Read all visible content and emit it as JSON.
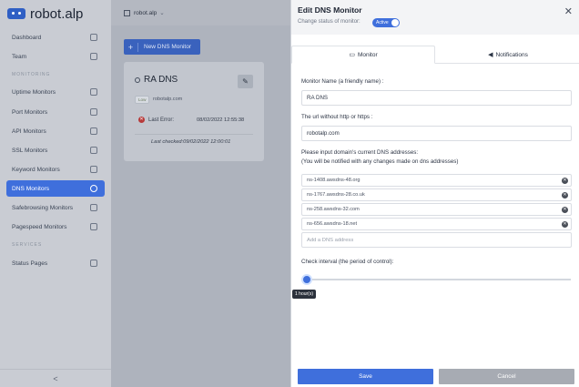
{
  "app": {
    "brand": "robot.alp"
  },
  "sidebar": {
    "items": [
      {
        "label": "Dashboard",
        "icon": "activity-icon"
      },
      {
        "label": "Team",
        "icon": "user-icon"
      },
      {
        "label": "Uptime Monitors",
        "icon": "calendar-icon"
      },
      {
        "label": "Port Monitors",
        "icon": "drive-icon"
      },
      {
        "label": "API Monitors",
        "icon": "rss-icon"
      },
      {
        "label": "SSL Monitors",
        "icon": "lock-icon"
      },
      {
        "label": "Keyword Monitors",
        "icon": "pen-icon"
      },
      {
        "label": "DNS Monitors",
        "icon": "check-circle-icon",
        "active": true
      },
      {
        "label": "Safebrowsing Monitors",
        "icon": "shield-icon"
      },
      {
        "label": "Pagespeed Monitors",
        "icon": "gauge-icon"
      },
      {
        "label": "Status Pages",
        "icon": "broadcast-icon"
      }
    ],
    "sections": [
      "MONITORING",
      "SERVICES"
    ],
    "collapse_label": "<"
  },
  "main": {
    "workspace": "robot.alp",
    "new_button": "New DNS Monitor",
    "card": {
      "title": "RA DNS",
      "badge": "Low",
      "url": "robotalp.com",
      "error_label": "Last Error:",
      "error_value": "08/02/2022 12:55:38",
      "last_checked": "Last checked:09/02/2022 12:00:01"
    }
  },
  "panel": {
    "title": "Edit DNS Monitor",
    "subtitle": "Change status of monitor:",
    "status": "Active",
    "tabs": [
      {
        "label": "Monitor",
        "icon": "monitor-icon",
        "active": true
      },
      {
        "label": "Notifications",
        "icon": "megaphone-icon",
        "active": false
      }
    ],
    "name_label": "Monitor Name (a friendly name) :",
    "name_value": "RA DNS",
    "url_label": "The url without http or https :",
    "url_value": "robotalp.com",
    "dns_label_1": "Please input domain's current DNS addresses:",
    "dns_label_2": "(You will be notified with any changes made on dns addresses)",
    "dns_addresses": [
      "ns-1408.awsdns-48.org",
      "ns-1767.awsdns-28.co.uk",
      "ns-258.awsdns-32.com",
      "ns-656.awsdns-18.net"
    ],
    "dns_placeholder": "Add a DNS address",
    "interval_label": "Check interval (the period of control):",
    "interval_value": "1 hour(s)",
    "save_label": "Save",
    "cancel_label": "Cancel"
  },
  "colors": {
    "accent": "#3f6fdc",
    "error": "#b73a3a"
  }
}
